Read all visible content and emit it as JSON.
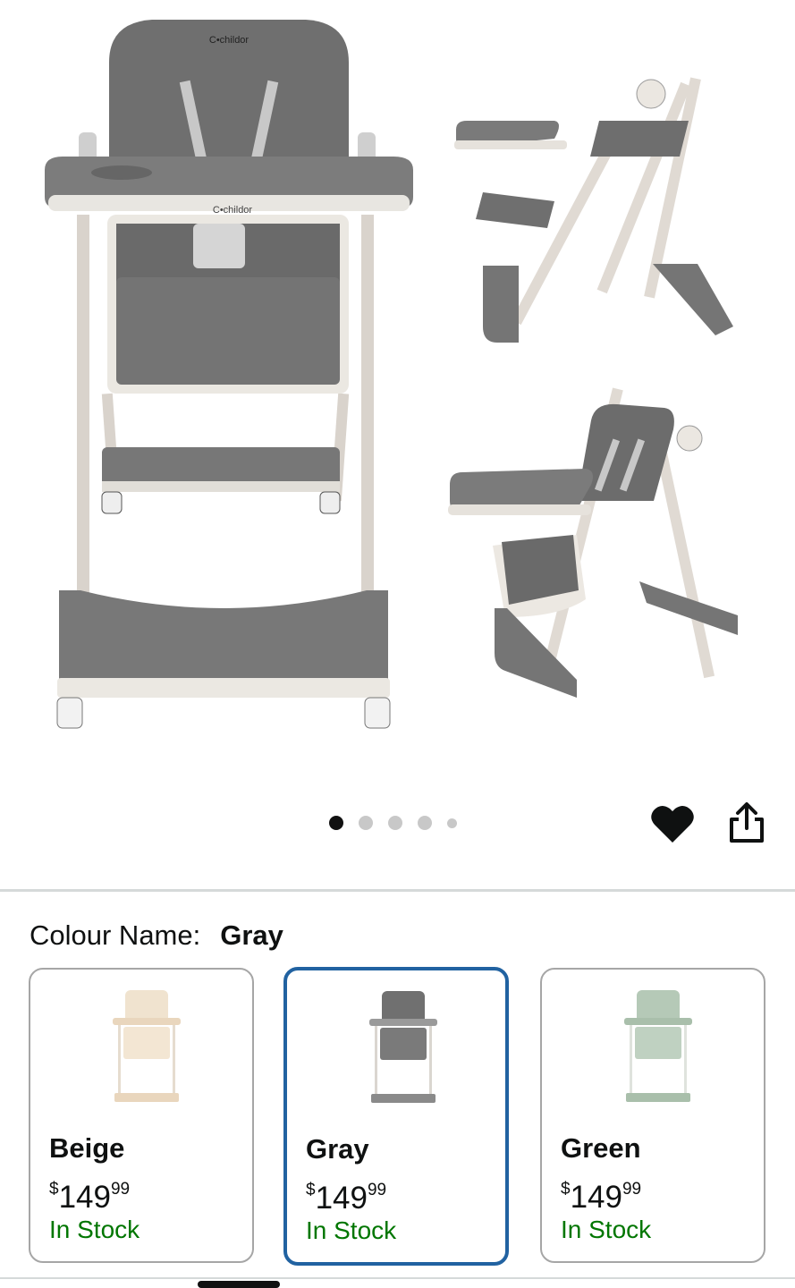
{
  "gallery": {
    "brand_logo": "C•childor",
    "page_count": 5,
    "current_page": 1
  },
  "actions": {
    "wishlist_icon": "heart-icon",
    "share_icon": "share-icon"
  },
  "variation": {
    "label": "Colour Name:",
    "selected_value": "Gray"
  },
  "swatches": [
    {
      "name": "Beige",
      "price_symbol": "$",
      "price_whole": "149",
      "price_fraction": "99",
      "stock": "In Stock",
      "selected": false,
      "seat_color": "#f0e3cf",
      "frame_color": "#e9d6bd"
    },
    {
      "name": "Gray",
      "price_symbol": "$",
      "price_whole": "149",
      "price_fraction": "99",
      "stock": "In Stock",
      "selected": true,
      "seat_color": "#707070",
      "frame_color": "#9a9a9a"
    },
    {
      "name": "Green",
      "price_symbol": "$",
      "price_whole": "149",
      "price_fraction": "99",
      "stock": "In Stock",
      "selected": false,
      "seat_color": "#b5c9b7",
      "frame_color": "#a9bfab"
    }
  ],
  "colors": {
    "selected_border": "#2162a1",
    "in_stock": "#007600"
  }
}
